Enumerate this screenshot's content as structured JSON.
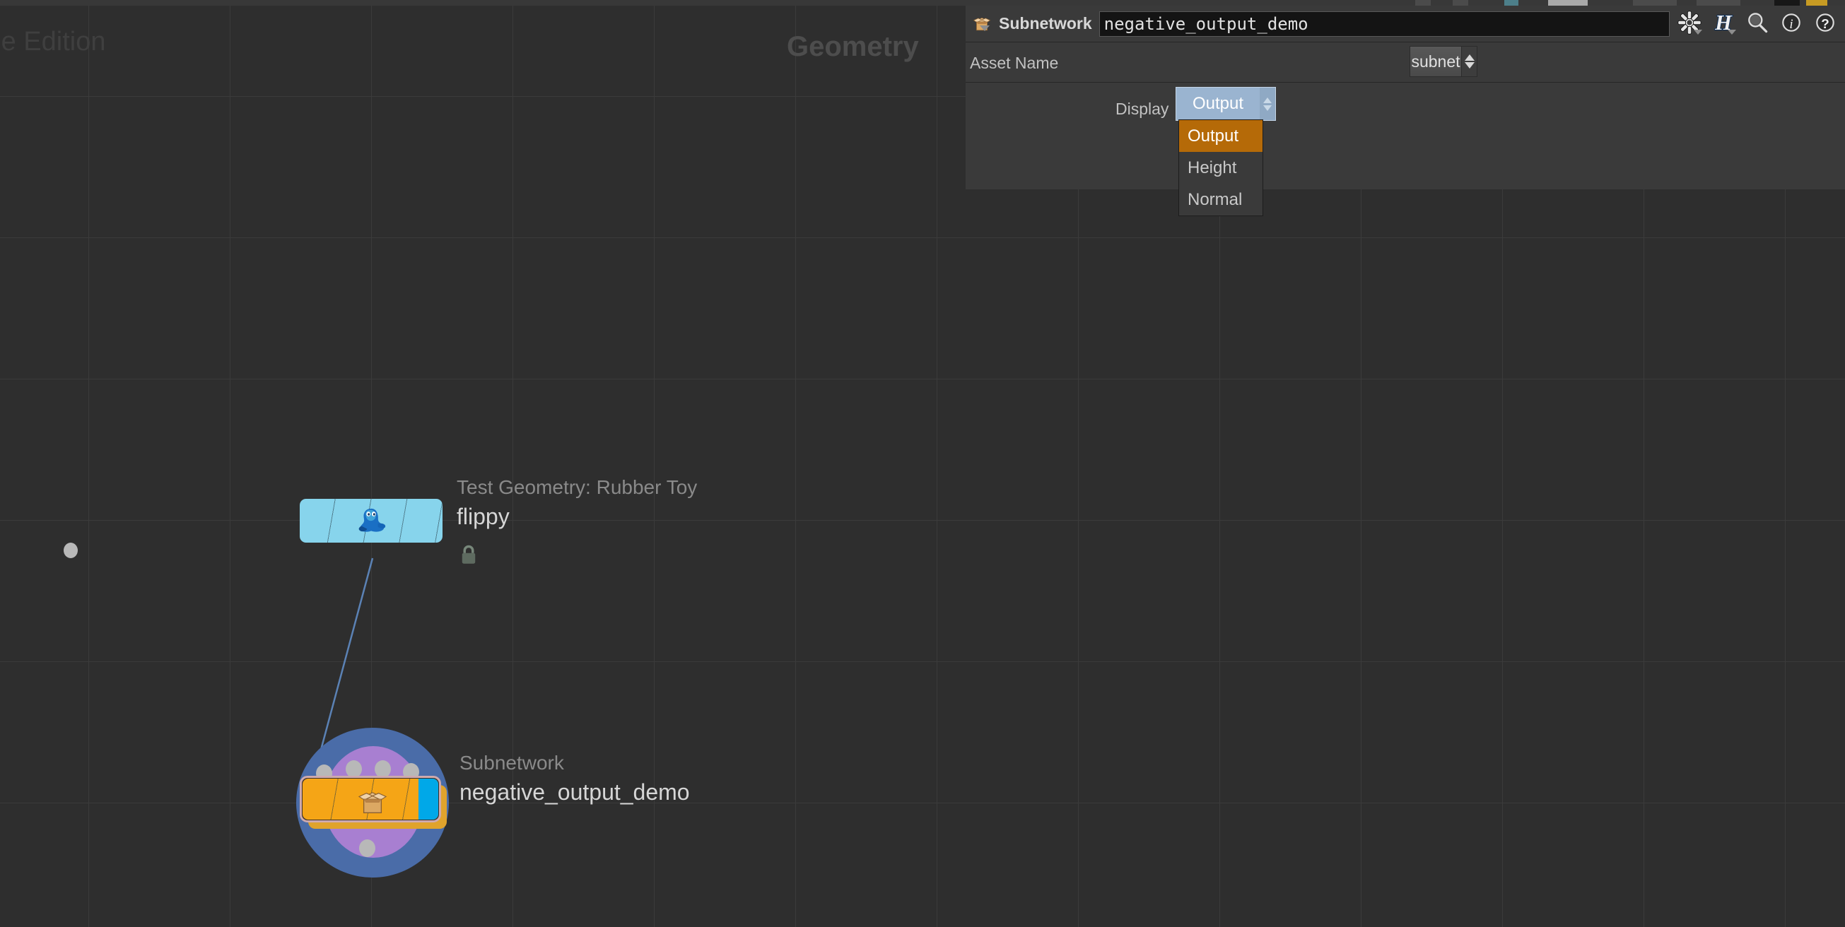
{
  "app": {
    "edition_watermark": "die Edition",
    "context_watermark": "Geometry"
  },
  "network": {
    "nodes": [
      {
        "id": "flippy",
        "type_label": "Test Geometry: Rubber Toy",
        "name": "flippy",
        "icon": "rubber-toy-icon",
        "color": "#87d4ec",
        "locked": true,
        "lock_icon": "lock-icon"
      },
      {
        "id": "negative_output_demo",
        "type_label": "Subnetwork",
        "name": "negative_output_demo",
        "icon": "open-box-icon",
        "color": "#f5a516",
        "flag_color": "#00a8e8",
        "selected": true,
        "input_count": 4,
        "output_count": 1
      }
    ]
  },
  "parameter_panel": {
    "node_type_icon": "open-box-icon",
    "node_type_label": "Subnetwork",
    "node_name_value": "negative_output_demo",
    "header_icons": [
      {
        "name": "gear-icon",
        "glyph": "✻",
        "has_caret": true
      },
      {
        "name": "houdini-h-icon",
        "glyph": "H",
        "has_caret": true
      },
      {
        "name": "search-icon",
        "glyph": "🔍",
        "has_caret": false
      },
      {
        "name": "info-icon",
        "glyph": "i",
        "has_caret": false
      },
      {
        "name": "help-icon",
        "glyph": "?",
        "has_caret": false
      }
    ],
    "rows": [
      {
        "label": "Asset Name",
        "control": "menu",
        "value": "subnet"
      },
      {
        "label": "Display",
        "control": "menu",
        "value": "Output",
        "open": true,
        "options": [
          "Output",
          "Height",
          "Normal"
        ],
        "selected_index": 0
      }
    ]
  },
  "colors": {
    "accent_orange": "#b56a08",
    "node_orange": "#f5a516",
    "node_blue": "#87d4ec",
    "flag_cyan": "#00a8e8",
    "halo_outer": "#4a6ca8",
    "halo_inner": "#a87fd1",
    "selection_border": "#ceaaae",
    "menu_active": "#9ab4d0",
    "canvas_bg": "#2e2e2e",
    "panel_bg": "#3a3a3a"
  }
}
